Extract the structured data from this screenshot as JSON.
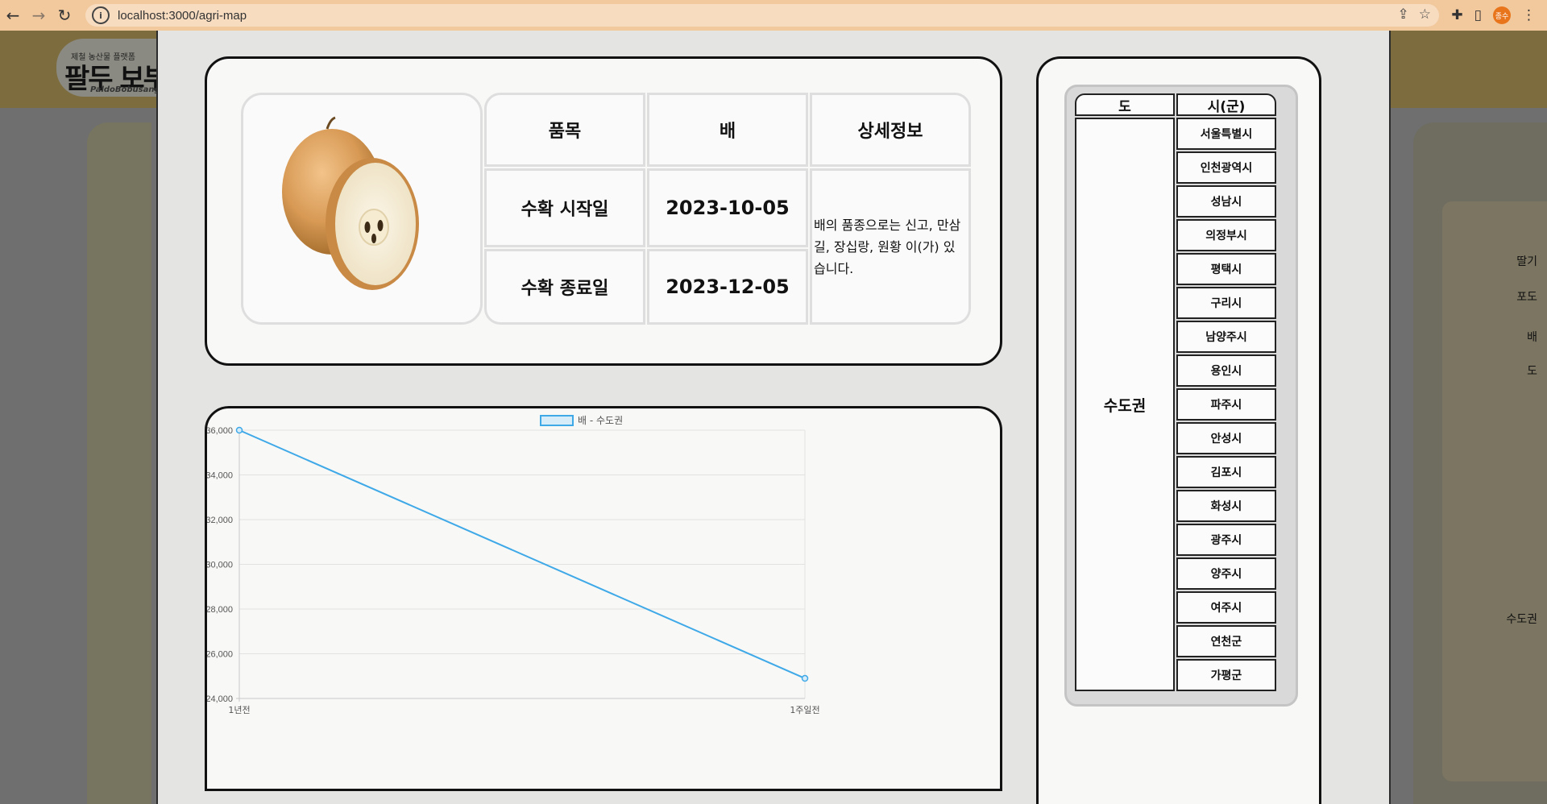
{
  "browser": {
    "url": "localhost:3000/agri-map",
    "profile_initials": "종수"
  },
  "background": {
    "logo_tagline": "제철 농산물 플랫폼",
    "logo_title": "팔두 보부상",
    "logo_subtitle": "PaldoBobusang",
    "side_list": [
      "딸기",
      "포도",
      "배",
      "도",
      "수도권"
    ]
  },
  "info": {
    "image_alt": "배 이미지",
    "headers": {
      "item_label": "품목",
      "item_value": "배",
      "detail_label": "상세정보"
    },
    "harvest_start_label": "수확 시작일",
    "harvest_start_value": "2023-10-05",
    "harvest_end_label": "수확 종료일",
    "harvest_end_value": "2023-12-05",
    "detail_text": "배의 품종으로는 신고, 만삼길, 장십랑, 원황 이(가) 있습니다."
  },
  "chart_data": {
    "type": "line",
    "categories": [
      "1년전",
      "1주일전"
    ],
    "series": [
      {
        "name": "배 - 수도권",
        "values": [
          36000,
          24900
        ],
        "color": "#3fa9e8"
      }
    ],
    "ylim": [
      24000,
      36000
    ],
    "yticks": [
      "36,000",
      "34,000",
      "32,000",
      "30,000",
      "28,000",
      "26,000",
      "24,000"
    ],
    "ytick_values": [
      36000,
      34000,
      32000,
      30000,
      28000,
      26000,
      24000
    ],
    "grid": true,
    "legend": "top-center"
  },
  "regions": {
    "col_province": "도",
    "col_city": "시(군)",
    "province": "수도권",
    "cities": [
      "서울특별시",
      "인천광역시",
      "성남시",
      "의정부시",
      "평택시",
      "구리시",
      "남양주시",
      "용인시",
      "파주시",
      "안성시",
      "김포시",
      "화성시",
      "광주시",
      "양주시",
      "여주시",
      "연천군",
      "가평군"
    ]
  },
  "colors": {
    "browser_bar": "#f2c89d",
    "accent_line": "#3fa9e8",
    "card_border": "#111111"
  }
}
